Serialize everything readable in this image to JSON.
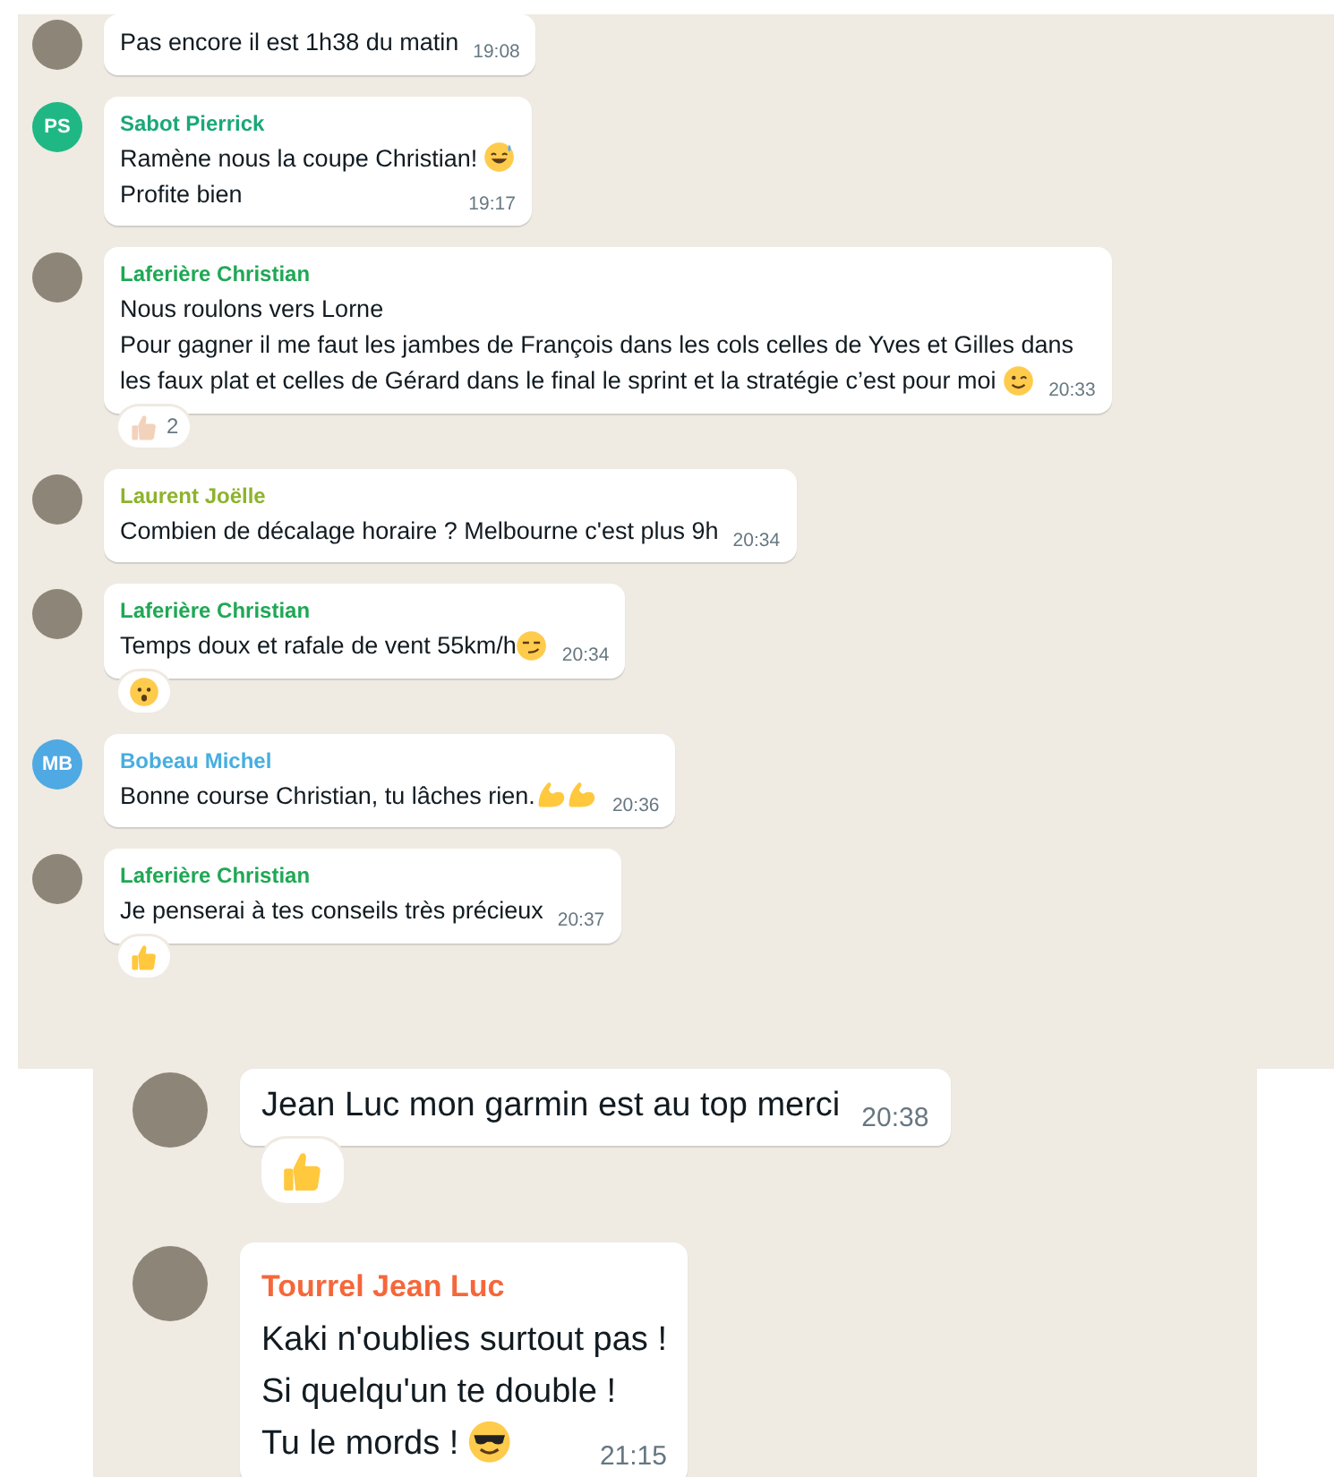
{
  "panels": [
    {
      "kind": "compact",
      "messages": [
        {
          "avatar": {
            "kind": "photo"
          },
          "lines": [
            [
              "Pas encore il est 1h38 du matin"
            ]
          ],
          "time": "19:08"
        },
        {
          "avatar": {
            "kind": "initials",
            "initials": "PS",
            "color": "#1fb885"
          },
          "sender": "Sabot Pierrick",
          "color": "#1aa878",
          "lines": [
            [
              "Ramène nous la coupe Christian! ",
              {
                "kind": "sweat-smile"
              }
            ],
            [
              "Profite bien"
            ]
          ],
          "time": "19:17"
        },
        {
          "avatar": {
            "kind": "photo"
          },
          "sender": "Laferière Christian",
          "color": "#1fa855",
          "lines": [
            [
              "Nous roulons vers Lorne"
            ],
            [
              "Pour gagner il me faut les jambes de François dans les cols celles de Yves et Gilles dans"
            ],
            [
              "les faux plat et celles de Gérard dans le final le sprint et la stratégie c’est pour moi ",
              {
                "kind": "wink"
              }
            ]
          ],
          "time": "20:33",
          "reactions": [
            {
              "kind": "thumbs-up-light",
              "count": "2"
            }
          ]
        },
        {
          "avatar": {
            "kind": "photo"
          },
          "sender": "Laurent Joëlle",
          "color": "#8db32c",
          "lines": [
            [
              "Combien de décalage horaire ? Melbourne c'est plus 9h"
            ]
          ],
          "time": "20:34"
        },
        {
          "avatar": {
            "kind": "photo"
          },
          "sender": "Laferière Christian",
          "color": "#1fa855",
          "lines": [
            [
              "Temps doux et rafale de vent 55km/h",
              {
                "kind": "smirk"
              }
            ]
          ],
          "time": "20:34",
          "reactions": [
            {
              "kind": "hushed"
            }
          ]
        },
        {
          "avatar": {
            "kind": "initials",
            "initials": "MB",
            "color": "#4fa9e3"
          },
          "sender": "Bobeau Michel",
          "color": "#47aee0",
          "lines": [
            [
              "Bonne course Christian, tu lâches rien.",
              {
                "kind": "flexed-biceps"
              },
              {
                "kind": "flexed-biceps"
              }
            ]
          ],
          "time": "20:36"
        },
        {
          "avatar": {
            "kind": "photo"
          },
          "sender": "Laferière Christian",
          "color": "#1fa855",
          "lines": [
            [
              "Je penserai à tes conseils très précieux"
            ]
          ],
          "time": "20:37",
          "reactions": [
            {
              "kind": "thumbs-up"
            }
          ]
        }
      ]
    },
    {
      "kind": "large",
      "messages": [
        {
          "avatar": {
            "kind": "photo"
          },
          "lines": [
            [
              "Jean Luc mon garmin est au top merci"
            ]
          ],
          "time": "20:38",
          "reactions": [
            {
              "kind": "thumbs-up"
            }
          ]
        },
        {
          "avatar": {
            "kind": "photo"
          },
          "sender": "Tourrel Jean Luc",
          "color": "#f5673a",
          "lines": [
            [
              "Kaki n'oublies surtout pas !"
            ],
            [
              "Si quelqu'un te double !"
            ],
            [
              "Tu le mords ! ",
              {
                "kind": "sunglasses"
              }
            ]
          ],
          "time": "21:15"
        }
      ]
    }
  ]
}
